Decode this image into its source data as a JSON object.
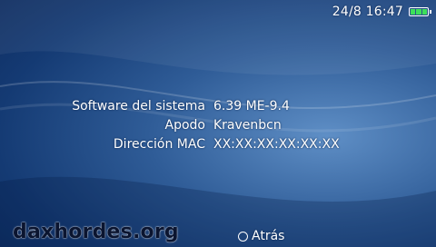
{
  "status": {
    "datetime": "24/8 16:47",
    "battery_icon": "battery-icon",
    "battery_level": 1.0,
    "battery_color": "#3de05a"
  },
  "info": {
    "rows": [
      {
        "label": "Software del sistema",
        "value": "6.39 ME-9.4"
      },
      {
        "label": "Apodo",
        "value": "Kravenbcn"
      },
      {
        "label": "Dirección MAC",
        "value": "XX:XX:XX:XX:XX:XX"
      }
    ]
  },
  "footer": {
    "back_icon": "circle-button-icon",
    "back_label": "Atrás"
  },
  "watermark": {
    "text": "daxhordes.org"
  },
  "colors": {
    "background_light": "#5f8fc6",
    "background_dark": "#0b2657",
    "text": "#ffffff"
  }
}
